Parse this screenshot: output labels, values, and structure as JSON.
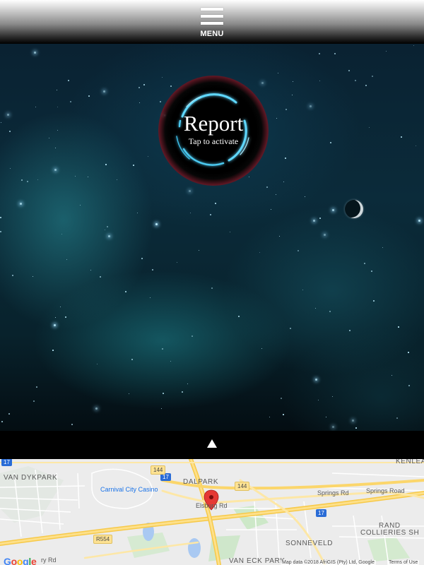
{
  "header": {
    "menu_label": "MENU"
  },
  "report": {
    "title": "Report",
    "subtitle": "Tap to activate"
  },
  "toggle": {
    "icon": "triangle-up-icon"
  },
  "map": {
    "areas": {
      "van_dykpark": "VAN DYKPARK",
      "dalpark": "DALPARK",
      "kenleaf": "KENLEA",
      "rand_collieries_1": "RAND",
      "rand_collieries_2": "COLLIERIES SH",
      "sonneveld": "SONNEVELD",
      "van_eck_park": "VAN ECK PARK"
    },
    "poi": {
      "casino": "Carnival City Casino"
    },
    "roads": {
      "springs_rd_1": "Springs Rd",
      "springs_rd_2": "Springs Road",
      "elsburg_rd": "Elsburg Rd",
      "ry_rd": "ry Rd"
    },
    "shields": {
      "r17_a": "17",
      "r17_b": "17",
      "r17_c": "17",
      "r144_a": "144",
      "r144_b": "144",
      "r554": "R554"
    },
    "logo_letters": [
      "G",
      "o",
      "o",
      "g",
      "l",
      "e"
    ],
    "logo_colors": [
      "#4285f4",
      "#ea4335",
      "#fbbc05",
      "#4285f4",
      "#34a853",
      "#ea4335"
    ],
    "attribution": "Map data ©2018 AfriGIS (Pty) Ltd, Google",
    "terms": "Terms of Use",
    "marker_color": "#e53935"
  }
}
